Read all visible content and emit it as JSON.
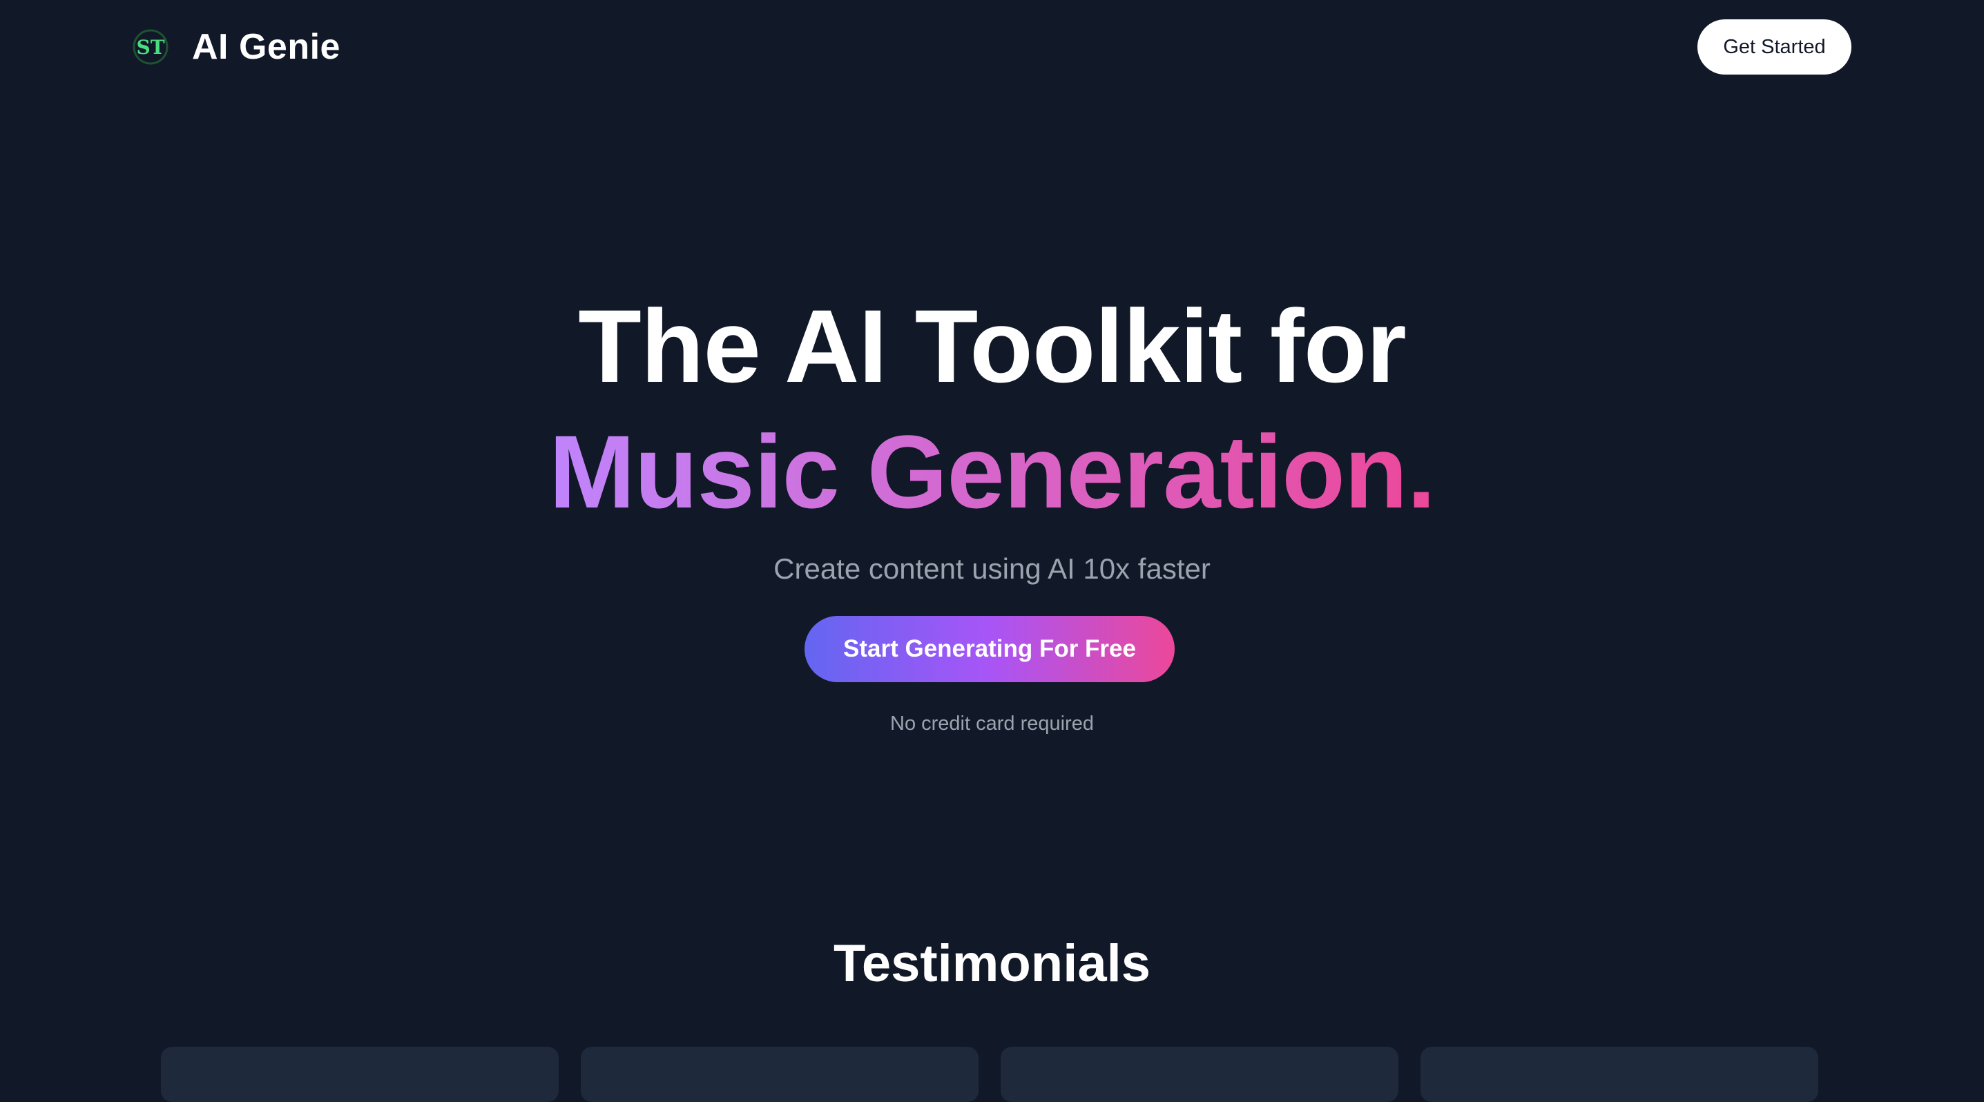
{
  "navbar": {
    "logo_text": "ST",
    "brand_name": "AI Genie",
    "get_started_label": "Get Started"
  },
  "hero": {
    "title_line1": "The AI Toolkit for",
    "title_line2": "Music Generation.",
    "subtitle": "Create content using AI 10x faster",
    "cta_label": "Start Generating For Free",
    "note": "No credit card required"
  },
  "testimonials": {
    "title": "Testimonials",
    "cards": [
      {},
      {},
      {},
      {}
    ]
  },
  "colors": {
    "background": "#111827",
    "card_background": "#1e293b",
    "logo_green": "#4ade80",
    "gradient_start": "#6366f1",
    "gradient_mid": "#a855f7",
    "gradient_end": "#ec4899",
    "muted_text": "#9ca3af"
  }
}
